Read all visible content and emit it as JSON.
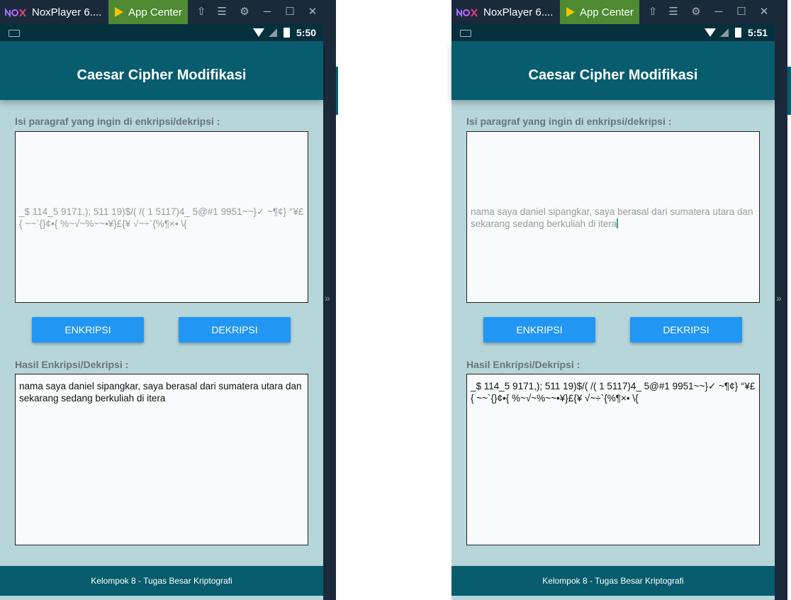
{
  "windows": [
    {
      "title": "NoxPlayer 6....",
      "app_center": "App Center",
      "status_time": "5:50",
      "app_title": "Caesar Cipher Modifikasi",
      "input_label": "Isi paragraf yang ingin di enkripsi/dekripsi :",
      "input_text": "_$ 114_5 9171,); 511 19)$/( /( 1 5117)4_ 5@#1 9951~~}✓ ~¶¢} °¥£{ ~~`{}¢•{ %~√~%~~•¥}£{¥ √~÷`{%¶×• \\{",
      "encrypt_label": "ENKRIPSI",
      "decrypt_label": "DEKRIPSI",
      "output_label": "Hasil Enkripsi/Dekripsi :",
      "output_text": "nama saya daniel sipangkar, saya berasal dari sumatera utara dan sekarang sedang berkuliah di itera",
      "footer": "Kelompok 8 - Tugas Besar Kriptografi"
    },
    {
      "title": "NoxPlayer 6....",
      "app_center": "App Center",
      "status_time": "5:51",
      "app_title": "Caesar Cipher Modifikasi",
      "input_label": "Isi paragraf yang ingin di enkripsi/dekripsi :",
      "input_text": "nama saya daniel sipangkar, saya berasal dari sumatera utara dan sekarang sedang berkuliah di itera",
      "encrypt_label": "ENKRIPSI",
      "decrypt_label": "DEKRIPSI",
      "output_label": "Hasil Enkripsi/Dekripsi :",
      "output_text": "_$ 114_5 9171,); 511 19)$/( /( 1 5117)4_ 5@#1 9951~~}✓ ~¶¢} °¥£{ ~~`{}¢•{ %~√~%~~•¥}£{¥ √~÷`{%¶×• \\{",
      "footer": "Kelompok 8 - Tugas Besar Kriptografi"
    }
  ],
  "colors": {
    "titlebar": "#1b2a3a",
    "app_center": "#4d8a32",
    "status_bar": "#05303d",
    "app_bar": "#075c6e",
    "background": "#b6d6da",
    "button": "#2196f3"
  }
}
